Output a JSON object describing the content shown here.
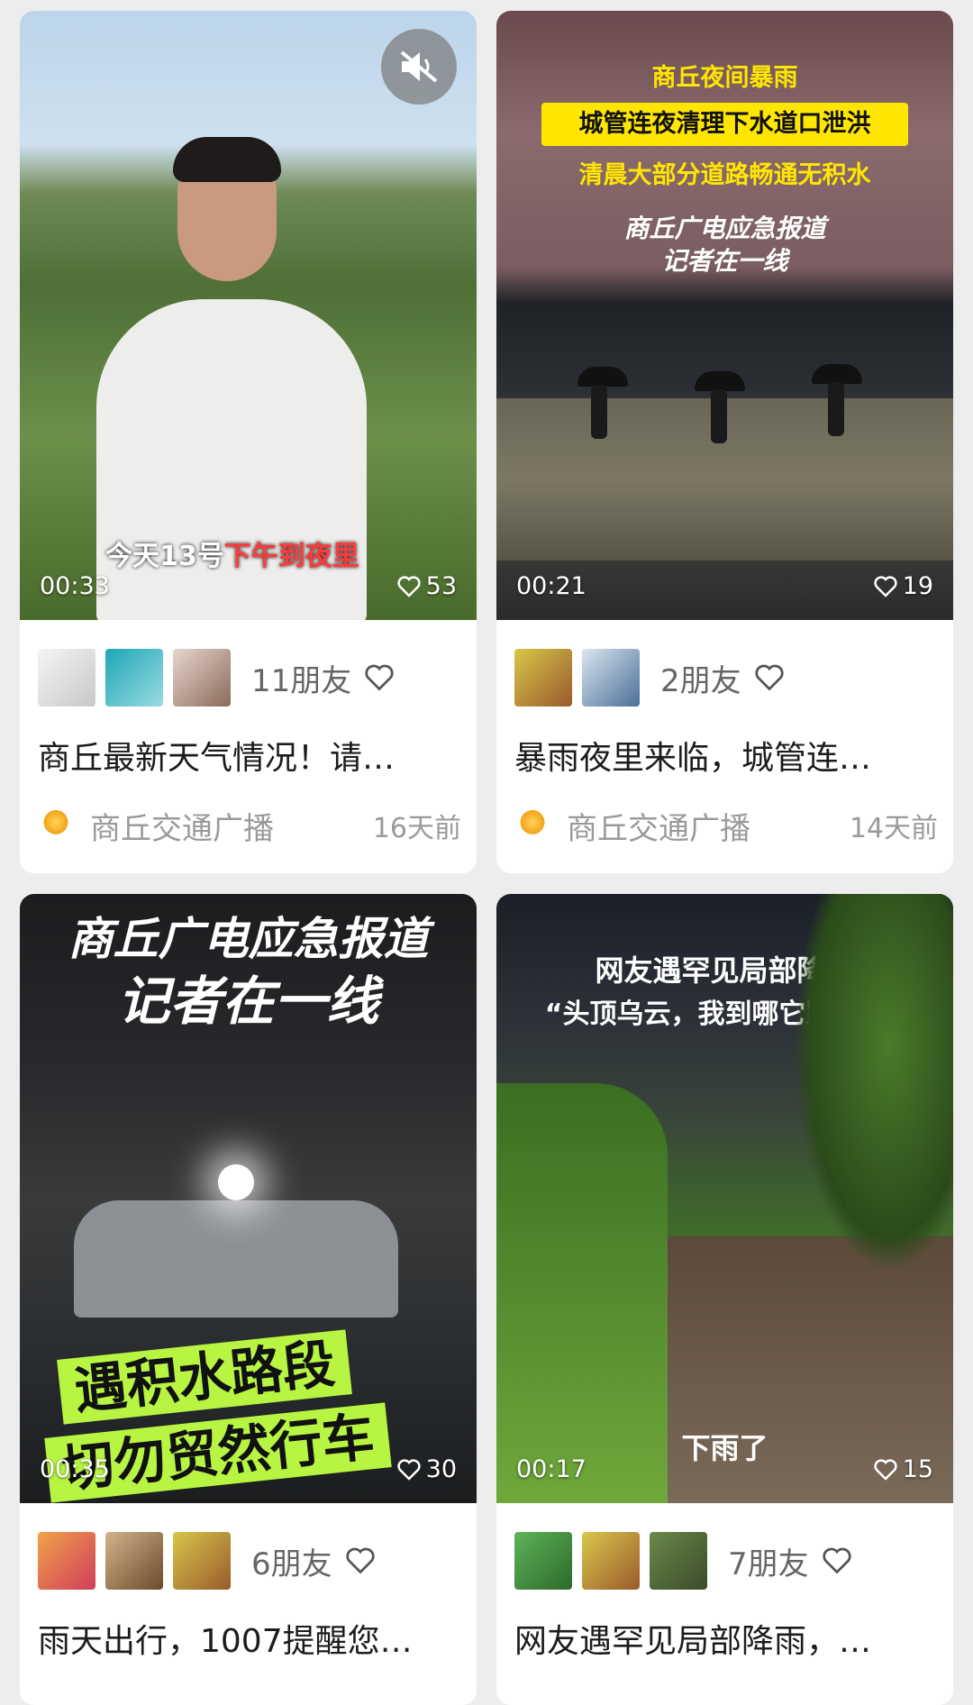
{
  "cards": [
    {
      "duration": "00:33",
      "likes": "53",
      "overlay": {
        "sub_white": "今天13号",
        "sub_red": "下午到夜里"
      },
      "friends_count": "11朋友",
      "title": "商丘最新天气情况！请…",
      "source": "商丘交通广播",
      "time": "16天前"
    },
    {
      "duration": "00:21",
      "likes": "19",
      "overlay": {
        "line1": "商丘夜间暴雨",
        "line2": "城管连夜清理下水道口泄洪",
        "line3": "清晨大部分道路畅通无积水",
        "logo1": "商丘广电应急报道",
        "logo2": "记者在一线"
      },
      "friends_count": "2朋友",
      "title": "暴雨夜里来临，城管连…",
      "source": "商丘交通广播",
      "time": "14天前"
    },
    {
      "duration": "00:35",
      "likes": "30",
      "overlay": {
        "logo1": "商丘广电应急报道",
        "logo2": "记者在一线",
        "green1": "遇积水路段",
        "green2": "切勿贸然行车"
      },
      "friends_count": "6朋友",
      "title": "雨天出行，1007提醒您…"
    },
    {
      "duration": "00:17",
      "likes": "15",
      "overlay": {
        "line1": "网友遇罕见局部降雨",
        "line2": "“头顶乌云，我到哪它跟到哪”",
        "bottom": "下雨了"
      },
      "friends_count": "7朋友",
      "title": "网友遇罕见局部降雨，…"
    }
  ],
  "colors": {
    "caption_yellow": "#ffe600",
    "caption_green": "#b7f542",
    "subtitle_red": "#ff3b3b"
  }
}
